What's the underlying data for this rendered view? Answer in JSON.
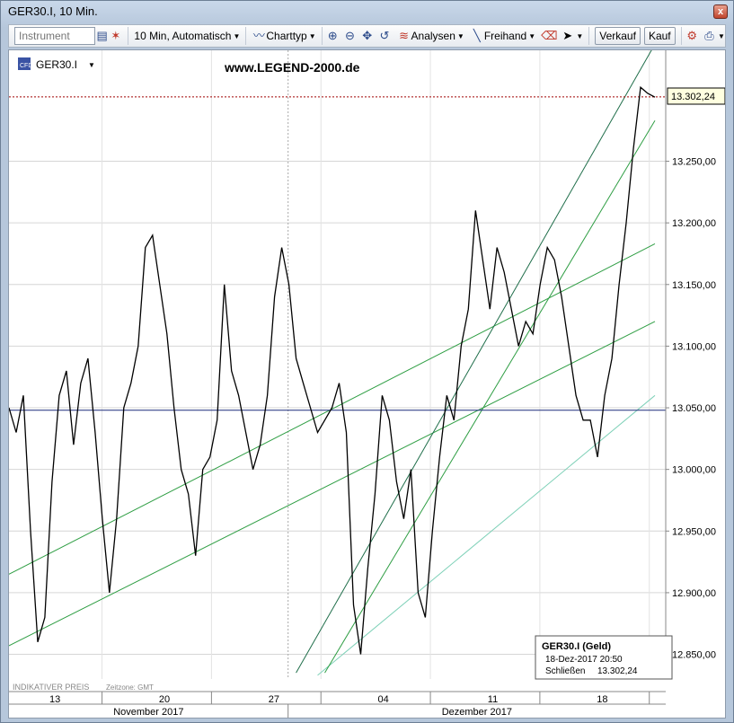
{
  "window": {
    "title": "GER30.I, 10 Min.",
    "close_label": "x"
  },
  "toolbar": {
    "instrument_placeholder": "Instrument",
    "interval_label": "10 Min,  Automatisch",
    "charttype_label": "Charttyp",
    "analysen_label": "Analysen",
    "freihand_label": "Freihand",
    "verkauf_label": "Verkauf",
    "kauf_label": "Kauf"
  },
  "chart": {
    "symbol": "GER30.I",
    "watermark": "www.LEGEND-2000.de",
    "indicative_label": "INDIKATIVER PREIS",
    "timezone_label": "Zeitzone: GMT",
    "last_price_label": "13.302,24",
    "info_title": "GER30.I (Geld)",
    "info_date": "18-Dez-2017 20:50",
    "info_close_label": "Schließen",
    "info_close_value": "13.302,24",
    "colors": {
      "price_line": "#000000",
      "trend_green": "#2f9e44",
      "trend_light": "#7fd1b8",
      "trend_dark": "#1f6e4a",
      "hline": "#1a2a7a",
      "last_price_line": "#a00000"
    }
  },
  "chart_data": {
    "type": "line",
    "title": "",
    "xlabel": "",
    "ylabel": "",
    "ylim": [
      12830,
      13340
    ],
    "x_tick_labels": [
      "13",
      "20",
      "27",
      "04",
      "11",
      "18"
    ],
    "month_labels": [
      "November 2017",
      "Dezember 2017"
    ],
    "y_tick_values": [
      12850,
      12900,
      12950,
      13000,
      13050,
      13100,
      13150,
      13200,
      13250
    ],
    "y_tick_labels": [
      "12.850,00",
      "12.900,00",
      "12.950,00",
      "13.000,00",
      "13.050,00",
      "13.100,00",
      "13.150,00",
      "13.200,00",
      "13.250,00"
    ],
    "series": [
      {
        "values": [
          13050,
          13030,
          13060,
          12950,
          12860,
          12880,
          12990,
          13060,
          13080,
          13020,
          13070,
          13090,
          13030,
          12960,
          12900,
          12960,
          13050,
          13070,
          13100,
          13180,
          13190,
          13150,
          13110,
          13050,
          13000,
          12980,
          12930,
          13000,
          13010,
          13040,
          13150,
          13080,
          13060,
          13030,
          13000,
          13020,
          13060,
          13140,
          13180,
          13150,
          13090,
          13070,
          13050,
          13030,
          13040,
          13050,
          13070,
          13030,
          12890,
          12850,
          12920,
          12980,
          13060,
          13040,
          12990,
          12960,
          13000,
          12900,
          12880,
          12950,
          13010,
          13060,
          13040,
          13100,
          13130,
          13210,
          13170,
          13130,
          13180,
          13160,
          13130,
          13100,
          13120,
          13110,
          13150,
          13180,
          13170,
          13140,
          13100,
          13060,
          13040,
          13040,
          13010,
          13060,
          13090,
          13150,
          13200,
          13260,
          13310,
          13305,
          13302
        ]
      }
    ],
    "hline_value": 13048,
    "last_price": 13302.24
  }
}
